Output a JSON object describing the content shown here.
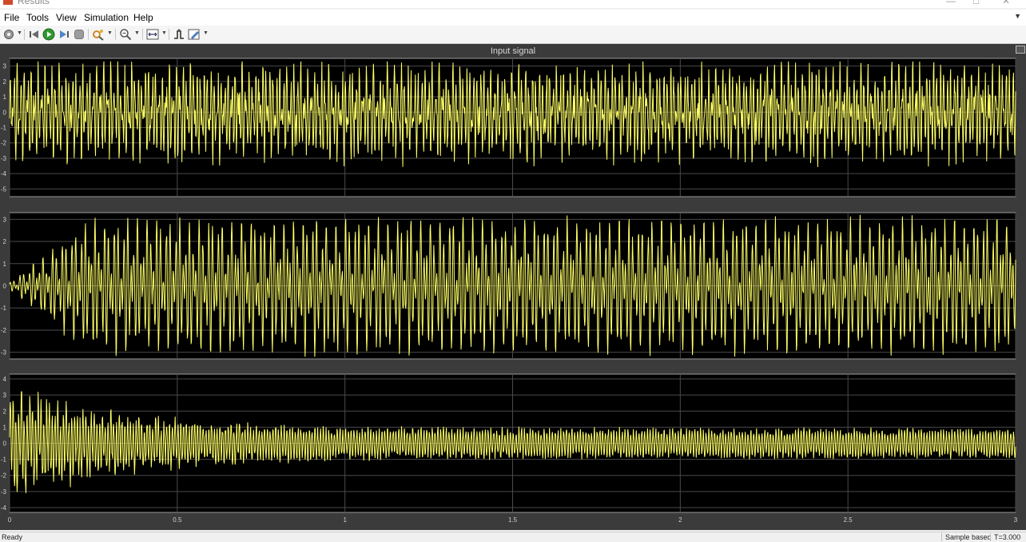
{
  "window": {
    "title": "Results"
  },
  "menu": [
    "File",
    "Tools",
    "View",
    "Simulation",
    "Help"
  ],
  "toolbar": {
    "icons": [
      "settings-icon",
      "step-back-icon",
      "run-icon",
      "step-forward-icon",
      "stop-icon",
      "highlight-icon",
      "zoom-icon",
      "scale-axes-icon",
      "triggers-icon",
      "edit-icon"
    ]
  },
  "scope": {
    "title": "Input signal",
    "background": "#000000",
    "trace_color": "#ffff66"
  },
  "chart_data": [
    {
      "type": "line",
      "title": "Input signal",
      "xlim": [
        0,
        3
      ],
      "ylim": [
        -5.5,
        3.5
      ],
      "y_ticks": [
        3,
        2,
        1,
        0,
        -1,
        -2,
        -3,
        -4,
        -5
      ],
      "x_ticks": [
        0,
        0.5,
        1,
        1.5,
        2,
        2.5,
        3
      ],
      "grid": true,
      "series": [
        {
          "description": "dense oscillation, amplitude about ±3.3, minimum near -5.3"
        }
      ]
    },
    {
      "type": "line",
      "title": "",
      "xlim": [
        0,
        3
      ],
      "ylim": [
        -3.3,
        3.3
      ],
      "y_ticks": [
        3,
        2,
        1,
        0,
        -1,
        -2,
        -3
      ],
      "x_ticks": [
        0,
        0.5,
        1,
        1.5,
        2,
        2.5,
        3
      ],
      "grid": true,
      "series": [
        {
          "description": "oscillation starting near 0 and growing to about ±3.2"
        }
      ]
    },
    {
      "type": "line",
      "title": "",
      "xlim": [
        0,
        3
      ],
      "ylim": [
        -4.3,
        4.3
      ],
      "y_ticks": [
        4,
        3,
        2,
        1,
        0,
        -1,
        -2,
        -3,
        -4
      ],
      "x_ticks": [
        0,
        0.5,
        1,
        1.5,
        2,
        2.5,
        3
      ],
      "x_tick_labels": [
        "0",
        "0.5",
        "1",
        "1.5",
        "2",
        "2.5",
        "3"
      ],
      "grid": true,
      "series": [
        {
          "description": "oscillation decaying from about ±3 to settle at about ±1"
        }
      ]
    }
  ],
  "status": {
    "left": "Ready",
    "mode": "Sample based",
    "time": "T=3.000"
  }
}
